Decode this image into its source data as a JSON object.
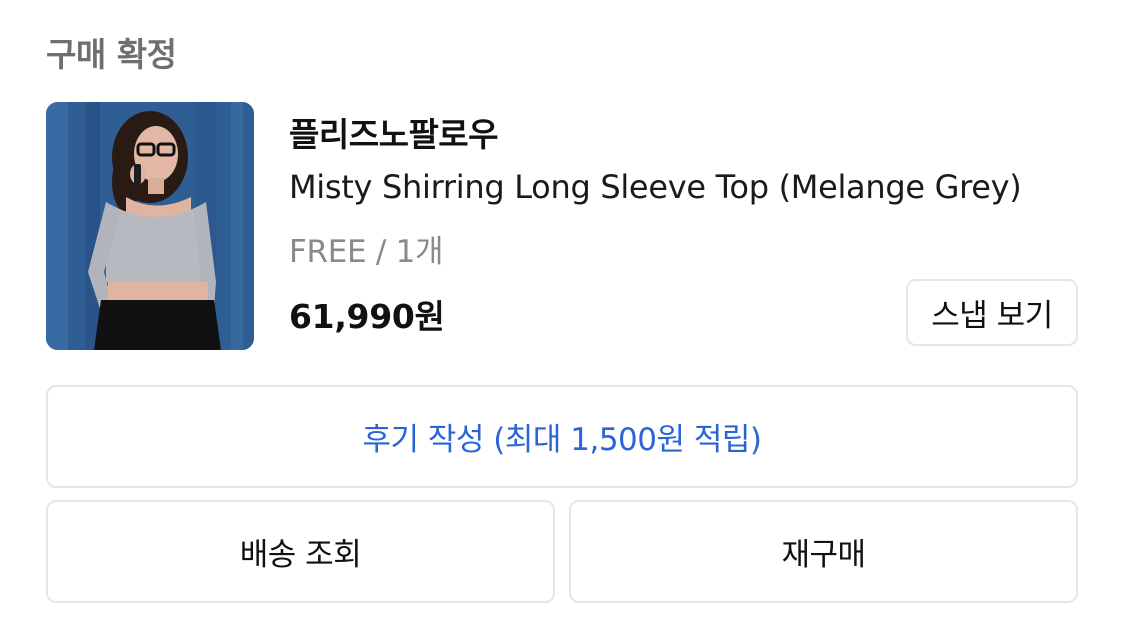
{
  "order": {
    "status_label": "구매 확정"
  },
  "product": {
    "image_icon": "product-photo",
    "brand": "플리즈노팔로우",
    "name": "Misty Shirring Long Sleeve Top (Melange Grey)",
    "option": "FREE / 1개",
    "price": "61,990원"
  },
  "actions": {
    "snap_label": "스냅 보기",
    "review_label": "후기 작성 (최대 1,500원 적립)",
    "track_label": "배송 조회",
    "rebuy_label": "재구매"
  },
  "colors": {
    "review_text": "#2b64d6",
    "border": "#e6e6e6",
    "muted": "#8a8a8a"
  }
}
